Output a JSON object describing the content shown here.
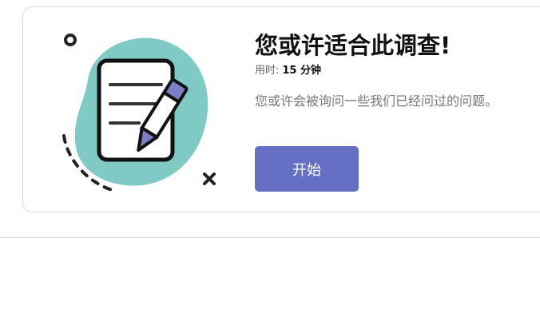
{
  "survey_card": {
    "title": "您或许适合此调查!",
    "duration_label": "用时:",
    "duration_value": "15 分钟",
    "description": "您或许会被询问一些我们已经问过的问题。",
    "start_button": "开始"
  },
  "colors": {
    "accent": "#6570c4",
    "illustration_blob": "#7fcac4",
    "pen": "#7a7fc6"
  },
  "icons": {
    "illustration": "survey-document-pen-illustration"
  }
}
